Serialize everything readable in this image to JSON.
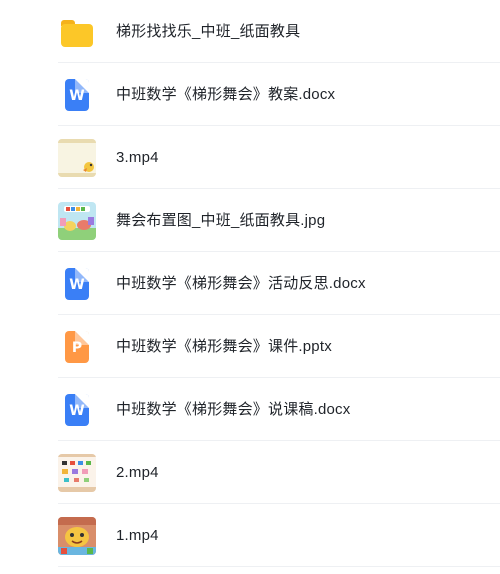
{
  "files": [
    {
      "name": "梯形找找乐_中班_纸面教具",
      "type": "folder",
      "icon": "folder-icon"
    },
    {
      "name": "中班数学《梯形舞会》教案.docx",
      "type": "docx",
      "icon": "word-doc-icon",
      "glyph": "W"
    },
    {
      "name": "3.mp4",
      "type": "video",
      "icon": "video-thumbnail"
    },
    {
      "name": "舞会布置图_中班_纸面教具.jpg",
      "type": "image",
      "icon": "image-thumbnail"
    },
    {
      "name": "中班数学《梯形舞会》活动反思.docx",
      "type": "docx",
      "icon": "word-doc-icon",
      "glyph": "W"
    },
    {
      "name": "中班数学《梯形舞会》课件.pptx",
      "type": "pptx",
      "icon": "ppt-doc-icon",
      "glyph": "P"
    },
    {
      "name": "中班数学《梯形舞会》说课稿.docx",
      "type": "docx",
      "icon": "word-doc-icon",
      "glyph": "W"
    },
    {
      "name": "2.mp4",
      "type": "video",
      "icon": "video-thumbnail"
    },
    {
      "name": "1.mp4",
      "type": "video",
      "icon": "video-thumbnail"
    }
  ],
  "colors": {
    "word": "#3a7ff6",
    "ppt": "#ff9845",
    "folder": "#fcc728",
    "text": "#1f2329",
    "divider": "#eef0f3"
  }
}
